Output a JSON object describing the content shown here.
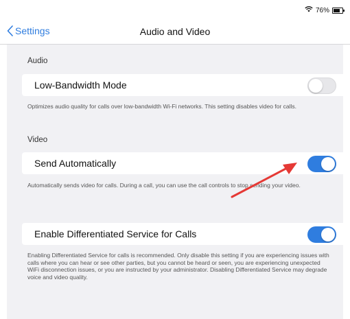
{
  "status_bar": {
    "wifi_icon": "wifi-icon",
    "battery_text": "76%",
    "battery_level": 0.76
  },
  "nav": {
    "back_label": "Settings",
    "title": "Audio and Video"
  },
  "audio": {
    "header": "Audio",
    "low_bandwidth_label": "Low-Bandwidth Mode",
    "low_bandwidth_on": false,
    "low_bandwidth_note": "Optimizes audio quality for calls over low-bandwidth Wi-Fi networks. This setting disables video for calls."
  },
  "video": {
    "header": "Video",
    "send_auto_label": "Send Automatically",
    "send_auto_on": true,
    "send_auto_note": "Automatically sends video for calls. During a call, you can use the call controls to stop sending your video."
  },
  "dscp": {
    "label": "Enable Differentiated Service for Calls",
    "on": true,
    "note": "Enabling Differentiated Service for calls is recommended.  Only disable this setting if you are experiencing issues with calls where you can hear or see other parties, but you cannot be heard or seen, you are experiencing unexpected WiFi disconnection issues, or you are instructed by your administrator. Disabling Differentiated Service may degrade voice and video quality."
  },
  "colors": {
    "accent": "#2f7ddf",
    "arrow": "#e53935",
    "background": "#f1f1f4"
  }
}
